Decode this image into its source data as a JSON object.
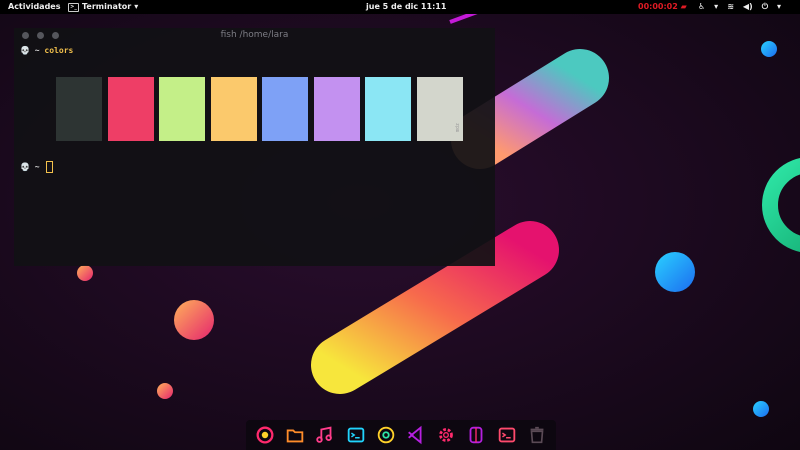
{
  "topbar": {
    "activities": "Actividades",
    "app_name": "Terminator",
    "clock": "jue 5 de dic  11:11",
    "recording": "00:00:02",
    "icons": [
      "accessibility-icon",
      "wifi-icon",
      "volume-icon",
      "power-icon"
    ]
  },
  "terminal": {
    "title": "fish /home/lara",
    "prompt_symbol": "💀 ~",
    "command": "colors",
    "second_prompt": "💀 ~",
    "side_label": "mdz",
    "swatch_colors": [
      "#2d3433",
      "#ee3e66",
      "#c4ef88",
      "#fbc96c",
      "#7ea1f6",
      "#c391f0",
      "#8be6f4",
      "#d3d6cc"
    ]
  },
  "dock": {
    "apps": [
      {
        "name": "app-launcher-icon",
        "color": "#ff2a6d"
      },
      {
        "name": "files-icon",
        "color": "#ff8c2a"
      },
      {
        "name": "music-icon",
        "color": "#ff3c8a"
      },
      {
        "name": "terminal-icon",
        "color": "#21d4fd"
      },
      {
        "name": "chrome-icon",
        "color": "#ffd12a"
      },
      {
        "name": "vscode-icon",
        "color": "#b620e0"
      },
      {
        "name": "settings-icon",
        "color": "#ff2a6d"
      },
      {
        "name": "switch-icon",
        "color": "#b620e0"
      },
      {
        "name": "terminator-icon",
        "color": "#ff4a6d"
      },
      {
        "name": "trash-icon",
        "color": "#5a4a55"
      }
    ]
  },
  "colors": {
    "accent_yellow": "#f3c14c",
    "record_red": "#e01b24"
  }
}
